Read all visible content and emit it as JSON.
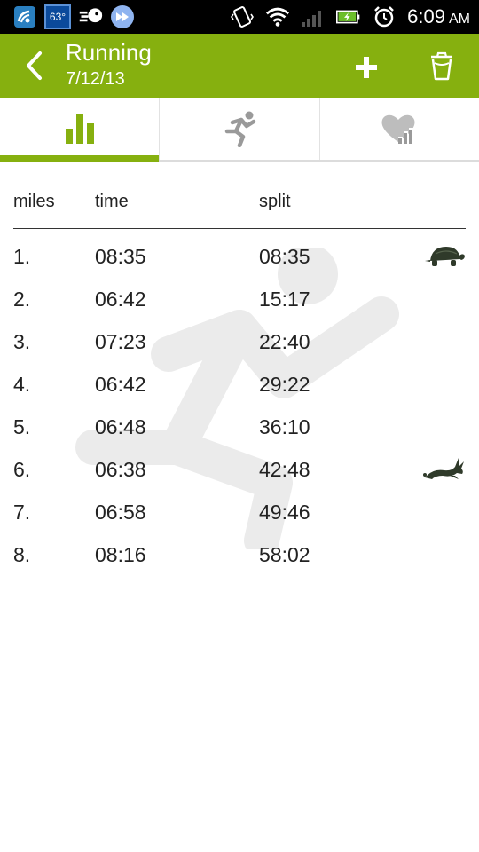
{
  "status_bar": {
    "temperature": "63°",
    "time": "6:09",
    "ampm": "AM"
  },
  "action_bar": {
    "title": "Running",
    "subtitle": "7/12/13"
  },
  "tabs": [
    {
      "icon": "bar-chart-icon",
      "active": true
    },
    {
      "icon": "runner-icon",
      "active": false
    },
    {
      "icon": "heart-chart-icon",
      "active": false
    }
  ],
  "table": {
    "headers": {
      "miles": "miles",
      "time": "time",
      "split": "split"
    },
    "rows": [
      {
        "mile": "1.",
        "time": "08:35",
        "split": "08:35",
        "badge": "turtle-icon"
      },
      {
        "mile": "2.",
        "time": "06:42",
        "split": "15:17",
        "badge": ""
      },
      {
        "mile": "3.",
        "time": "07:23",
        "split": "22:40",
        "badge": ""
      },
      {
        "mile": "4.",
        "time": "06:42",
        "split": "29:22",
        "badge": ""
      },
      {
        "mile": "5.",
        "time": "06:48",
        "split": "36:10",
        "badge": ""
      },
      {
        "mile": "6.",
        "time": "06:38",
        "split": "42:48",
        "badge": "rabbit-icon"
      },
      {
        "mile": "7.",
        "time": "06:58",
        "split": "49:46",
        "badge": ""
      },
      {
        "mile": "8.",
        "time": "08:16",
        "split": "58:02",
        "badge": ""
      }
    ]
  },
  "colors": {
    "accent": "#86b00f",
    "tab_icon_inactive": "#9a9a9a"
  }
}
